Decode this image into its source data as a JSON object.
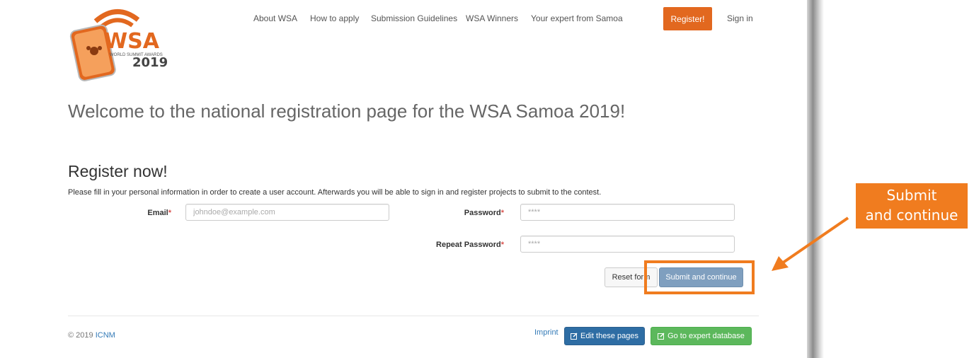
{
  "nav": {
    "links": [
      {
        "label": "About WSA"
      },
      {
        "label": "How to apply"
      },
      {
        "label": "Submission Guidelines"
      },
      {
        "label": "WSA Winners"
      },
      {
        "label": "Your expert from Samoa"
      }
    ],
    "register_label": "Register!",
    "signin_label": "Sign in"
  },
  "logo": {
    "text_main": "WSA",
    "text_sub": "WORLD SUMMIT AWARDS",
    "year": "2019"
  },
  "welcome_title": "Welcome to the national registration page for the WSA Samoa 2019!",
  "register": {
    "title": "Register now!",
    "intro": "Please fill in your personal information in order to create a user account. Afterwards you will be able to sign in and register projects to submit to the contest.",
    "email_label": "Email",
    "email_placeholder": "johndoe@example.com",
    "password_label": "Password",
    "password_placeholder": "****",
    "repeat_password_label": "Repeat Password",
    "repeat_password_placeholder": "****",
    "required_mark": "*",
    "reset_label": "Reset form",
    "submit_label": "Submit and continue"
  },
  "footer": {
    "copyright": "© 2019",
    "org_link": "ICNM",
    "imprint_label": "Imprint",
    "edit_label": "Edit these pages",
    "expert_label": "Go to expert database"
  },
  "callout": {
    "line1": "Submit",
    "line2": "and continue"
  },
  "colors": {
    "accent_orange": "#e2681f",
    "callout_orange": "#f07c1f",
    "submit_blue": "#7f9fbf",
    "edit_blue": "#2e6da4",
    "expert_green": "#5cb85c",
    "link_blue": "#337ab7"
  },
  "icons": {
    "edit_icon": "edit-icon",
    "logo_icon": "wsa-logo-icon"
  }
}
